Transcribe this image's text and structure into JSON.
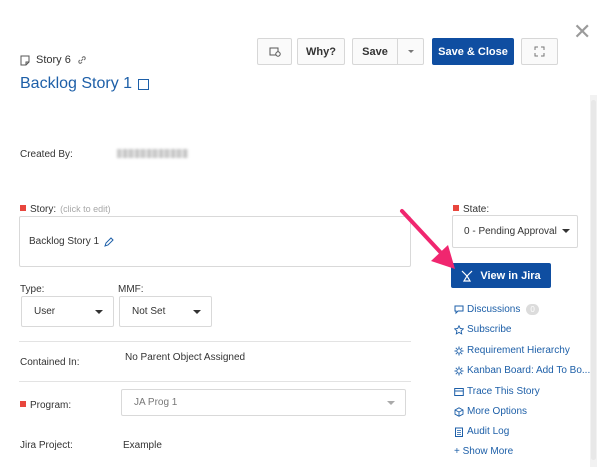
{
  "header": {
    "story_id": "Story 6",
    "title": "Backlog Story 1"
  },
  "toolbar": {
    "why_label": "Why?",
    "save_label": "Save",
    "save_close_label": "Save & Close"
  },
  "fields": {
    "created_by_label": "Created By:",
    "story_label": "Story:",
    "story_hint": "(click to edit)",
    "story_value": "Backlog Story 1",
    "type_label": "Type:",
    "type_value": "User",
    "mmf_label": "MMF:",
    "mmf_value": "Not Set",
    "contained_in_label": "Contained In:",
    "contained_in_value": "No Parent Object Assigned",
    "program_label": "Program:",
    "program_value": "JA Prog 1",
    "jira_project_label": "Jira Project:",
    "jira_project_value": "Example"
  },
  "state": {
    "label": "State:",
    "value": "0 - Pending Approval"
  },
  "sidebar": {
    "view_in_jira": "View in Jira",
    "discussions": "Discussions",
    "discussions_count": "0",
    "subscribe": "Subscribe",
    "requirement_hierarchy": "Requirement Hierarchy",
    "kanban": "Kanban Board: Add To Bo...",
    "trace": "Trace This Story",
    "more_options": "More Options",
    "audit_log": "Audit Log",
    "show_more": "+ Show More"
  },
  "colors": {
    "primary": "#0f4ea1",
    "link": "#1d5fa8",
    "required": "#e8463d",
    "annotation_arrow": "#f0266f"
  }
}
